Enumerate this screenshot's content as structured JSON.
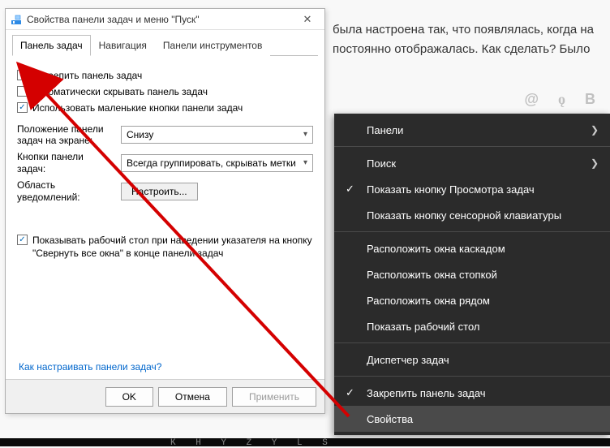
{
  "bg": {
    "line1": "была настроена так, что появлялась, когда на",
    "line2": "постоянно отображалась. Как сделать? Было"
  },
  "dialog": {
    "title": "Свойства панели задач и меню \"Пуск\"",
    "tabs": {
      "taskbar": "Панель задач",
      "navigation": "Навигация",
      "toolbars": "Панели инструментов"
    },
    "chk_lock": "Закрепить панель задач",
    "chk_autohide": "Автоматически скрывать панель задач",
    "chk_small": "Использовать маленькие кнопки панели задач",
    "pos_label": "Положение панели задач на экране:",
    "pos_value": "Снизу",
    "btns_label": "Кнопки панели задач:",
    "btns_value": "Всегда группировать, скрывать метки",
    "notif_label": "Область уведомлений:",
    "notif_btn": "Настроить...",
    "chk_peek": "Показывать рабочий стол при наведении указателя на кнопку \"Свернуть все окна\" в конце панели задач",
    "help_link": "Как настраивать панели задач?",
    "ok": "OK",
    "cancel": "Отмена",
    "apply": "Применить"
  },
  "ctx": {
    "panels": "Панели",
    "search": "Поиск",
    "show_taskview": "Показать кнопку Просмотра задач",
    "show_touchkb": "Показать кнопку сенсорной клавиатуры",
    "cascade": "Расположить окна каскадом",
    "stack": "Расположить окна стопкой",
    "side": "Расположить окна рядом",
    "desktop": "Показать рабочий стол",
    "taskmgr": "Диспетчер задач",
    "lock": "Закрепить панель задач",
    "props": "Свойства"
  },
  "taskbar_text": "K H Y Z Y L   S"
}
